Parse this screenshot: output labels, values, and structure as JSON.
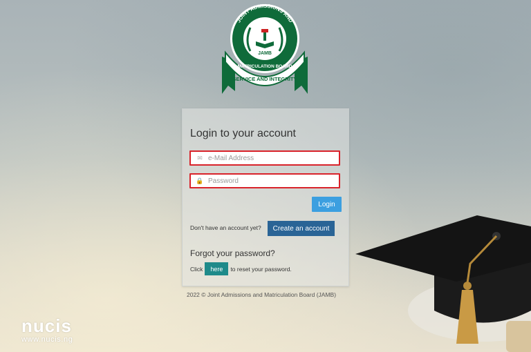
{
  "logo": {
    "top_text": "JOINT ADMISSIONS AND",
    "middle_text": "MATRICULATION BOARD",
    "acronym": "JAMB",
    "ribbon_text": "SERVICE AND INTEGRITY"
  },
  "login": {
    "heading": "Login to your account",
    "email_placeholder": "e-Mail Address",
    "password_placeholder": "Password",
    "login_button": "Login",
    "signup_question": "Don't have an account yet?",
    "create_account_button": "Create an account",
    "forgot_heading": "Forgot your password?",
    "reset_prefix": "Click",
    "here_button": "here",
    "reset_suffix": "to reset your password."
  },
  "footer": {
    "copyright": "2022 © Joint Admissions and Matriculation Board (JAMB)"
  },
  "watermark": {
    "name": "nucis",
    "url": "www.nucis.ng"
  },
  "icons": {
    "email": "envelope-icon",
    "password": "lock-icon"
  },
  "colors": {
    "error_border": "#d9222a",
    "login_button": "#3c9fe0",
    "create_button": "#2a6496",
    "here_button": "#1e8a8a",
    "logo_green": "#0f6b3a"
  }
}
